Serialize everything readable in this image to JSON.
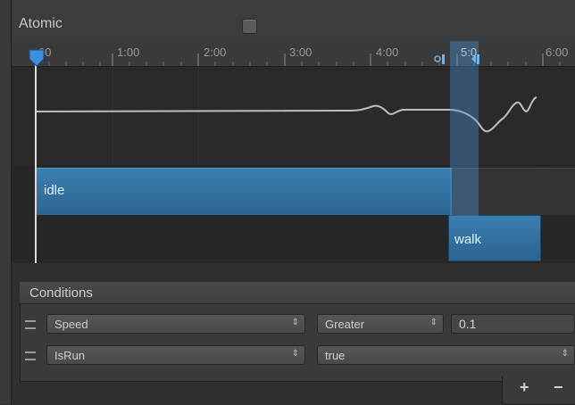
{
  "header": {
    "atomic_label": "Atomic"
  },
  "ruler": {
    "labels": [
      "1:00",
      "2:00",
      "3:00",
      "4:00",
      "5:0",
      "6:00"
    ],
    "first_label": "00"
  },
  "tracks": {
    "source_state": "idle",
    "destination_state": "walk"
  },
  "conditions": {
    "title": "Conditions",
    "rows": [
      {
        "parameter": "Speed",
        "mode": "Greater",
        "value": "0.1"
      },
      {
        "parameter": "IsRun",
        "mode": "true"
      }
    ],
    "add_label": "+",
    "remove_label": "−"
  },
  "colors": {
    "state_bar": "#3a7eb0",
    "transition_overlay": "#4696d7",
    "playhead": "#dcdcdc",
    "background": "#2f2f2f"
  }
}
